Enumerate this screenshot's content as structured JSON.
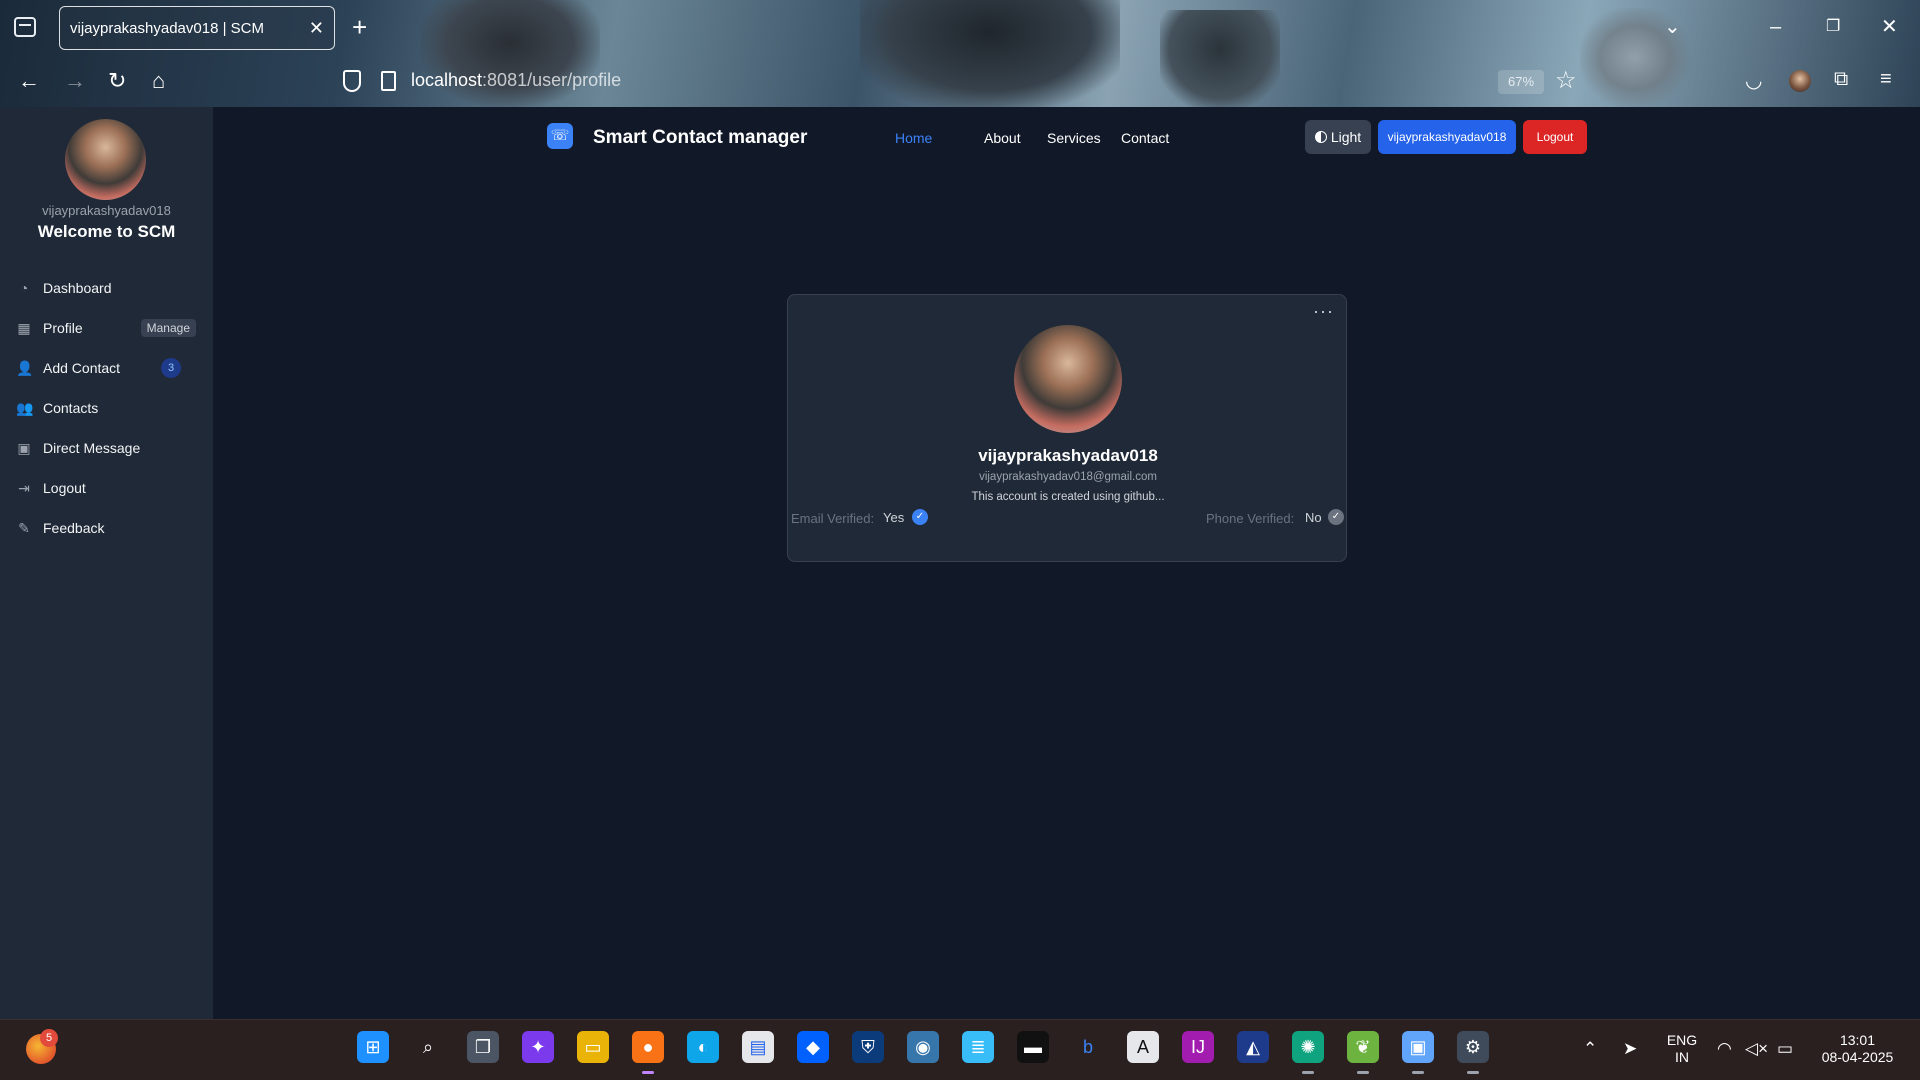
{
  "browser": {
    "tab_title": "vijayprakashyadav018 | SCM",
    "tab_close": "✕",
    "new_tab": "+",
    "url_host": "localhost",
    "url_rest": ":8081/user/profile",
    "zoom": "67%"
  },
  "app": {
    "title": "Smart Contact manager",
    "nav": [
      "Home",
      "About",
      "Services",
      "Contact"
    ],
    "theme_button": "Light",
    "user_button": "vijayprakashyadav018",
    "logout_button": "Logout"
  },
  "sidebar": {
    "username": "vijayprakashyadav018",
    "welcome": "Welcome to SCM",
    "items": [
      {
        "label": "Dashboard",
        "icon": "pie-chart-icon"
      },
      {
        "label": "Profile",
        "icon": "grid-icon",
        "badge": "Manage"
      },
      {
        "label": "Add Contact",
        "icon": "user-plus-icon",
        "badge": "3"
      },
      {
        "label": "Contacts",
        "icon": "users-icon"
      },
      {
        "label": "Direct Message",
        "icon": "briefcase-icon"
      },
      {
        "label": "Logout",
        "icon": "sign-out-icon"
      },
      {
        "label": "Feedback",
        "icon": "edit-icon"
      }
    ]
  },
  "profile": {
    "menu": "···",
    "name": "vijayprakashyadav018",
    "email": "vijayprakashyadav018@gmail.com",
    "about": "This account is created using github...",
    "email_verified_label": "Email Verified:",
    "email_verified_value": "Yes",
    "phone_verified_label": "Phone Verified:",
    "phone_verified_value": "No"
  },
  "taskbar": {
    "weather_badge": "5",
    "lang_line1": "ENG",
    "lang_line2": "IN",
    "time": "13:01",
    "date": "08-04-2025"
  },
  "colors": {
    "accent": "#2563eb",
    "danger": "#dc2626",
    "background": "#111827",
    "sidebar": "#1f2937"
  }
}
